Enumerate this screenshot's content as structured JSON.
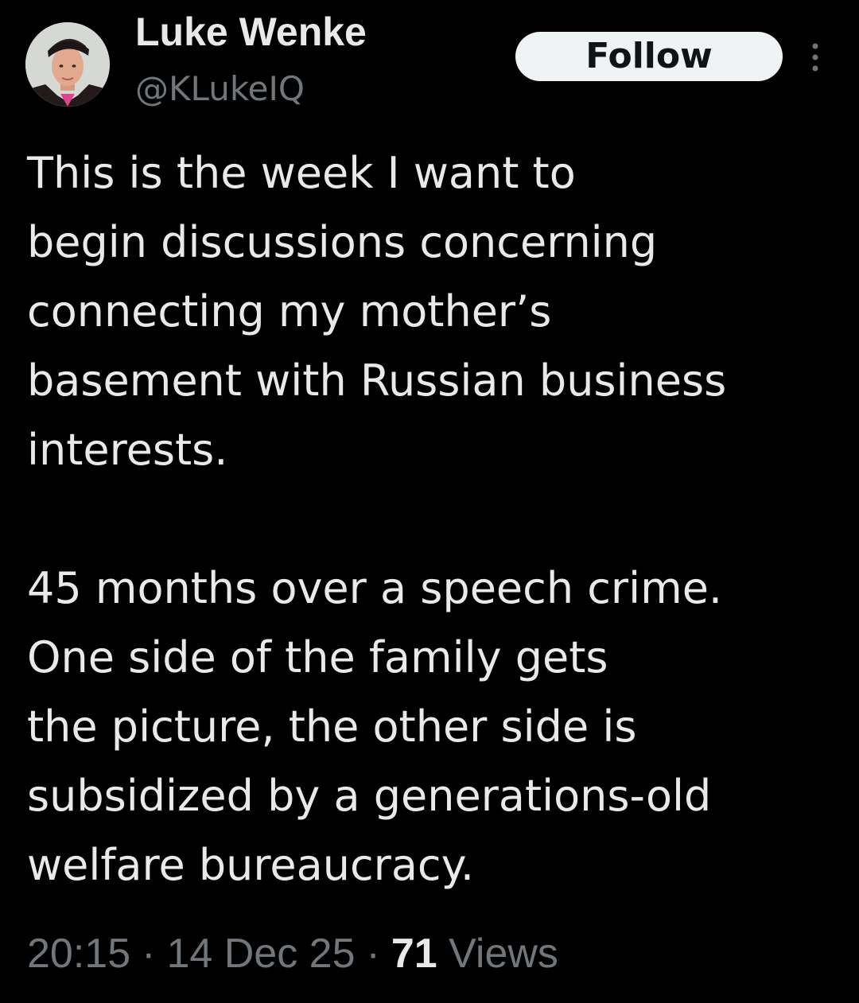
{
  "author": {
    "display_name": "Luke Wenke",
    "handle": "@KLukeIQ",
    "avatar_icon": "user-avatar-photo"
  },
  "actions": {
    "follow_label": "Follow",
    "more_icon": "more-vertical-icon"
  },
  "tweet": {
    "paragraph1": [
      "This is the week I want to",
      "begin discussions concerning",
      "connecting my mother’s",
      "basement with Russian business",
      "interests."
    ],
    "paragraph2": [
      "45 months over a speech crime.",
      "One side of the family gets",
      "the picture, the other side is",
      "subsidized by a generations-old",
      "welfare bureaucracy."
    ]
  },
  "meta": {
    "time": "20:15",
    "separator": "·",
    "date": "14 Dec 25",
    "views_count": "71",
    "views_label": "Views"
  },
  "colors": {
    "background": "#000000",
    "primary_text": "#e7e9ea",
    "secondary_text": "#71767b",
    "follow_bg": "#eff3f4",
    "follow_text": "#0f1419"
  }
}
